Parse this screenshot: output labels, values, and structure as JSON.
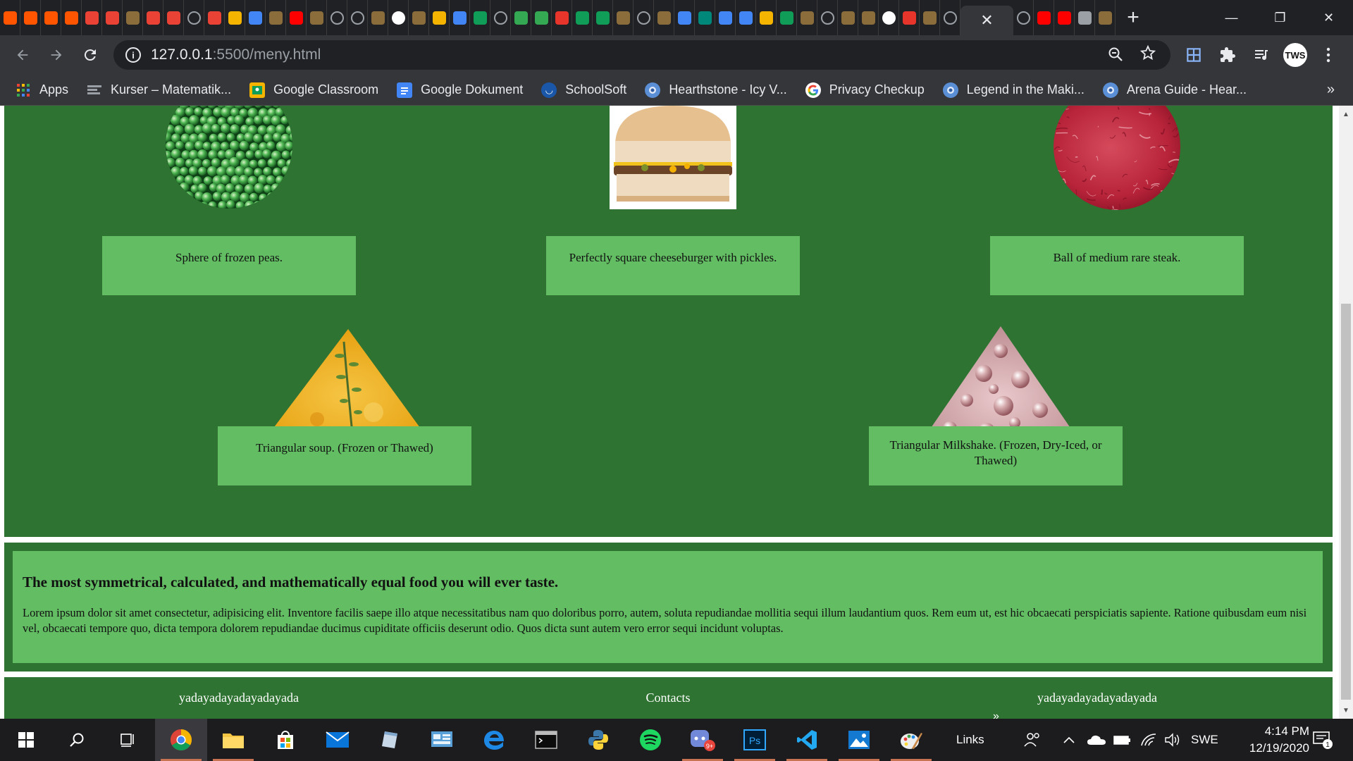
{
  "browser": {
    "tab_count_icons": [
      "soundcloud",
      "soundcloud",
      "soundcloud",
      "soundcloud",
      "gmail",
      "gmail",
      "misc",
      "gmail",
      "gmail",
      "globe",
      "gmail",
      "classroom",
      "docs",
      "misc",
      "youtube",
      "misc",
      "globe",
      "globe",
      "misc",
      "google",
      "misc",
      "classroom",
      "docs",
      "sheets",
      "globe",
      "drive",
      "drive",
      "adobe",
      "sheets",
      "sheets",
      "misc",
      "globe",
      "misc",
      "docs",
      "meet",
      "docs",
      "docs",
      "classroom",
      "sheets",
      "misc",
      "globe",
      "misc",
      "misc",
      "google",
      "adobe",
      "misc",
      "globe"
    ],
    "active_tab_close": "✕",
    "tail_tab_icons": [
      "globe",
      "youtube",
      "youtube",
      "audio",
      "misc"
    ],
    "new_tab": "+",
    "window_controls": {
      "minimize": "—",
      "restore": "❐",
      "close": "✕"
    },
    "url_host": "127.0.0.1",
    "url_rest": ":5500/meny.html",
    "bookmarks": [
      {
        "label": "Apps",
        "icon": "apps-icon",
        "color": "#4285f4"
      },
      {
        "label": "Kurser – Matematik...",
        "icon": "course-icon",
        "color": "#9aa0a6"
      },
      {
        "label": "Google Classroom",
        "icon": "classroom-icon",
        "color": "#f4b400"
      },
      {
        "label": "Google Dokument",
        "icon": "docs-icon",
        "color": "#4285f4"
      },
      {
        "label": "SchoolSoft",
        "icon": "schoolsoft-icon",
        "color": "#1a57a8"
      },
      {
        "label": "Hearthstone - Icy V...",
        "icon": "hearthstone-icon",
        "color": "#5a8fd6"
      },
      {
        "label": "Privacy Checkup",
        "icon": "google-icon",
        "color": "#ffffff"
      },
      {
        "label": "Legend in the Maki...",
        "icon": "hearthstone-icon",
        "color": "#5a8fd6"
      },
      {
        "label": "Arena Guide - Hear...",
        "icon": "hearthstone-icon",
        "color": "#5a8fd6"
      }
    ],
    "bookmarks_more": "»",
    "profile_label": "TWS"
  },
  "page": {
    "colors": {
      "dark_green": "#2e7331",
      "light_green": "#62bd63"
    },
    "items": [
      {
        "caption": "Sphere of frozen peas.",
        "shape": "circle",
        "image": "frozen-peas"
      },
      {
        "caption": "Perfectly square cheeseburger with pickles.",
        "shape": "square",
        "image": "cheeseburger"
      },
      {
        "caption": "Ball of medium rare steak.",
        "shape": "circle",
        "image": "steak"
      },
      {
        "caption": "Triangular soup. (Frozen or Thawed)",
        "shape": "triangle",
        "image": "soup"
      },
      {
        "caption": "Triangular Milkshake. (Frozen, Dry-Iced, or Thawed)",
        "shape": "triangle",
        "image": "milkshake"
      }
    ],
    "info": {
      "heading": "The most symmetrical, calculated, and mathematically equal food you will ever taste.",
      "body": "Lorem ipsum dolor sit amet consectetur, adipisicing elit. Inventore facilis saepe illo atque necessitatibus nam quo doloribus porro, autem, soluta repudiandae mollitia sequi illum laudantium quos. Rem eum ut, est hic obcaecati perspiciatis sapiente. Ratione quibusdam eum nisi vel, obcaecati tempore quo, dicta tempora dolorem repudiandae ducimus cupiditate officiis deserunt odio. Quos dicta sunt autem vero error sequi incidunt voluptas."
    },
    "footer": {
      "left": "yadayadayadayadayada",
      "center": "Contacts",
      "right": "yadayadayadayadayada"
    }
  },
  "taskbar": {
    "apps": [
      "start-icon",
      "search-icon",
      "task-view-icon",
      "chrome-icon",
      "file-explorer-icon",
      "store-icon",
      "mail-icon",
      "notes-icon",
      "control-panel-icon",
      "edge-icon",
      "terminal-icon",
      "python-icon",
      "spotify-icon",
      "discord-icon",
      "photoshop-icon",
      "vscode-icon",
      "photos-icon",
      "paint-icon"
    ],
    "links_label": "Links",
    "chevron": "»",
    "language": "SWE",
    "time": "4:14 PM",
    "date": "12/19/2020",
    "notification_badge": "1",
    "discord_badge": "9+"
  }
}
